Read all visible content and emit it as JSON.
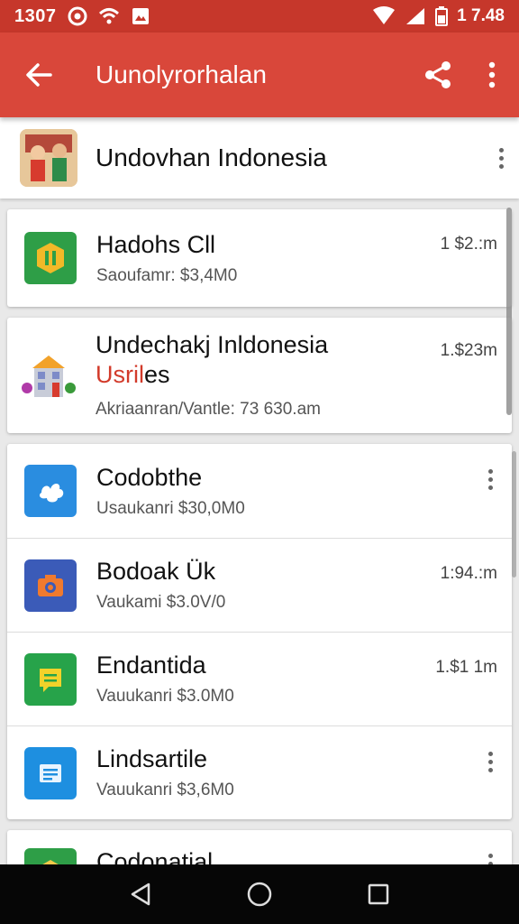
{
  "status_bar": {
    "time_left": "1307",
    "time_right": "1 7.48"
  },
  "app_bar": {
    "title": "Uunolyrorhalan"
  },
  "header": {
    "title": "Undovhan Indonesia"
  },
  "items": [
    {
      "name": "Hadohs Cll",
      "sub": "Saoufamr:  $3,4M0",
      "meta": "1 $2.:m",
      "icon_color": "#2e9e47",
      "icon_name": "shield-app-icon"
    },
    {
      "name": "Undechakj Inldonesia",
      "name_highlight": "Usril",
      "name_tail": "es",
      "sub": "Akriaanran/Vantle: 73 630.am",
      "meta": "1.$23m",
      "icon_name": "building-app-icon"
    },
    {
      "name": "Codobthe",
      "sub": "Usaukanri  $30,0M0",
      "meta": "",
      "icon_color": "#2a8de0",
      "icon_name": "puzzle-app-icon"
    },
    {
      "name": "Bodoak Ük",
      "sub": "Vaukami  $3.0V/0",
      "meta": "1:94.:m",
      "icon_color": "#3b5bb8",
      "icon_name": "camera-app-icon"
    },
    {
      "name": "Endantida",
      "sub": "Vauukanri  $3.0M0",
      "meta": "1.$1 1m",
      "icon_color": "#27a34a",
      "icon_name": "chat-app-icon"
    },
    {
      "name": "Lindsartile",
      "sub": "Vauukanri  $3,6M0",
      "meta": "",
      "icon_color": "#1e8fe0",
      "icon_name": "document-app-icon"
    },
    {
      "name": "Codonatial",
      "sub": "",
      "meta": "",
      "icon_color": "#2e9e47",
      "icon_name": "folder-app-icon"
    }
  ],
  "colors": {
    "status_bar": "#c6372b",
    "app_bar": "#d9473a",
    "highlight_text": "#d23a2a"
  }
}
